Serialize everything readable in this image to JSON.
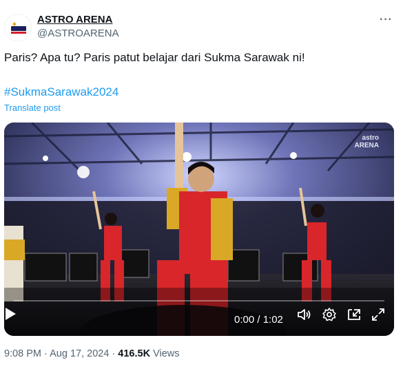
{
  "account": {
    "display_name": "ASTRO ARENA",
    "handle": "@ASTROARENA"
  },
  "post": {
    "text": "Paris? Apa tu? Paris patut belajar dari Sukma Sarawak ni!",
    "hashtag": "#SukmaSarawak2024",
    "translate_label": "Translate post"
  },
  "video": {
    "watermark_line1": "astro",
    "watermark_line2": "ARENA",
    "time_display": "0:00 / 1:02",
    "progress": 0.0
  },
  "meta": {
    "time": "9:08 PM",
    "separator": "·",
    "date": "Aug 17, 2024",
    "views_count": "416.5K",
    "views_label": "Views"
  },
  "icons": {
    "more": "more-options-icon",
    "play": "play-icon",
    "volume": "volume-icon",
    "settings": "gear-icon",
    "pip": "picture-in-picture-icon",
    "fullscreen": "fullscreen-icon"
  },
  "colors": {
    "link": "#1d9bf0",
    "secondary_text": "#536471",
    "costume_red": "#d8262b",
    "costume_gold": "#d9a826"
  }
}
